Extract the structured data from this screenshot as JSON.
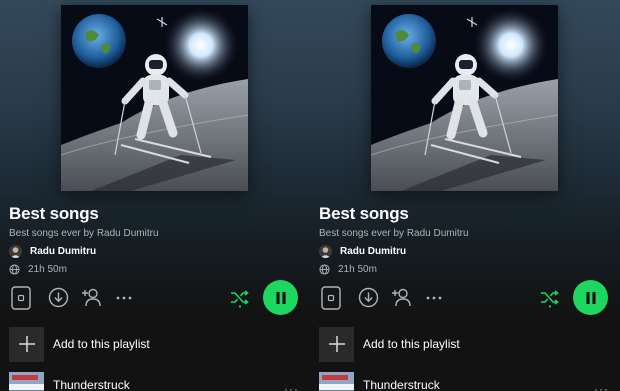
{
  "panels": [
    {
      "title": "Best songs",
      "description": "Best songs ever by Radu Dumitru",
      "owner": "Radu Dumitru",
      "duration": "21h 50m",
      "add_to_playlist_label": "Add to this playlist",
      "track_title": "Thunderstruck",
      "more_glyph": "···"
    },
    {
      "title": "Best songs",
      "description": "Best songs ever by Radu Dumitru",
      "owner": "Radu Dumitru",
      "duration": "21h 50m",
      "add_to_playlist_label": "Add to this playlist",
      "track_title": "Thunderstruck",
      "more_glyph": "···"
    }
  ],
  "icons": {
    "cover": "astronaut-skiing-on-moon-artwork",
    "avatar": "user-avatar",
    "duration": "globe-icon",
    "preview": "playlist-thumbnail-icon",
    "download": "download-icon",
    "add_user": "add-user-icon",
    "more": "more-options-icon",
    "shuffle": "smart-shuffle-icon",
    "pause": "pause-icon",
    "add": "plus-icon"
  },
  "colors": {
    "accent_green": "#1ed760",
    "background": "#121212",
    "secondary_text": "#b3b3b3"
  }
}
